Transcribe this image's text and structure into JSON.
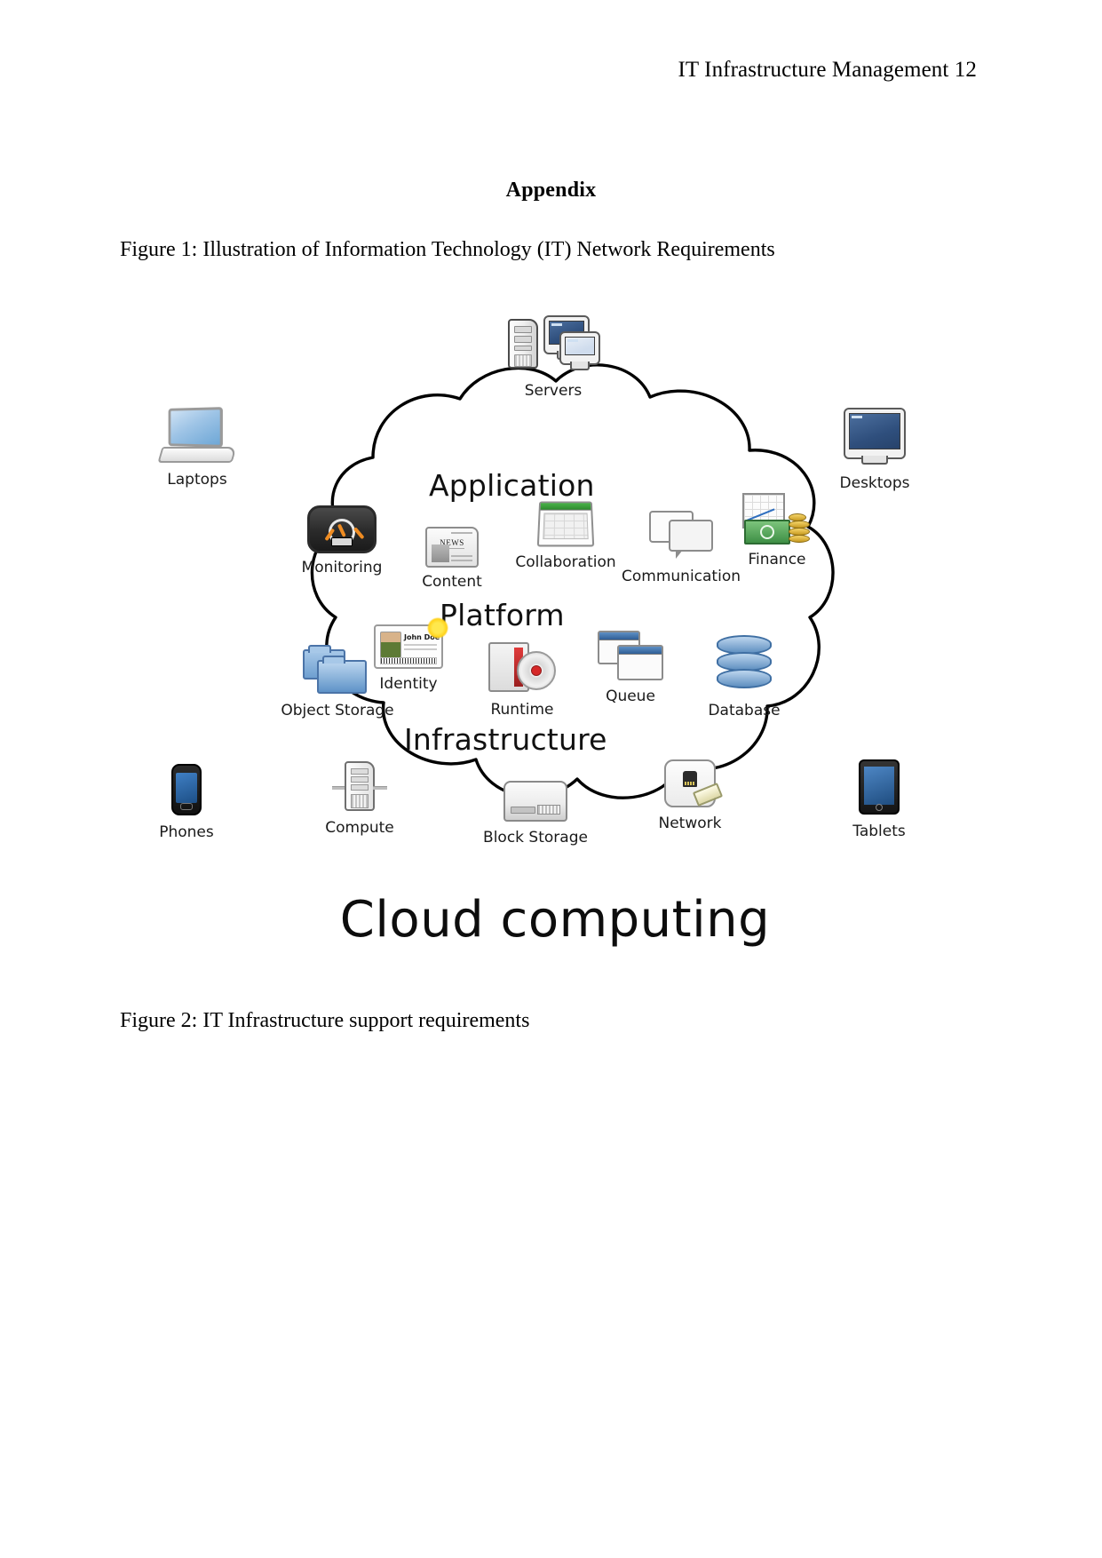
{
  "header": {
    "running_head": "IT Infrastructure Management 12"
  },
  "appendix": {
    "title": "Appendix"
  },
  "figures": {
    "figure1_caption": "Figure 1: Illustration of Information Technology (IT) Network Requirements",
    "figure2_caption": "Figure 2: IT Infrastructure support requirements"
  },
  "diagram": {
    "title": "Cloud computing",
    "tiers": [
      {
        "label": "Application"
      },
      {
        "label": "Platform"
      },
      {
        "label": "Infrastructure"
      }
    ],
    "external_devices": [
      {
        "label": "Servers",
        "icon": "servers-icon"
      },
      {
        "label": "Laptops",
        "icon": "laptop-icon"
      },
      {
        "label": "Desktops",
        "icon": "desktop-monitor-icon"
      },
      {
        "label": "Phones",
        "icon": "smartphone-icon"
      },
      {
        "label": "Tablets",
        "icon": "tablet-icon"
      }
    ],
    "application_services": [
      {
        "label": "Monitoring",
        "icon": "gauge-icon"
      },
      {
        "label": "Content",
        "icon": "newspaper-icon"
      },
      {
        "label": "Collaboration",
        "icon": "spreadsheet-icon"
      },
      {
        "label": "Communication",
        "icon": "chat-bubbles-icon"
      },
      {
        "label": "Finance",
        "icon": "money-coins-icon"
      }
    ],
    "platform_services": [
      {
        "label": "Object Storage",
        "icon": "folders-icon"
      },
      {
        "label": "Identity",
        "icon": "id-card-icon"
      },
      {
        "label": "Runtime",
        "icon": "disc-icon"
      },
      {
        "label": "Queue",
        "icon": "stacked-windows-icon"
      },
      {
        "label": "Database",
        "icon": "database-cylinder-icon"
      }
    ],
    "infrastructure_services": [
      {
        "label": "Compute",
        "icon": "rack-server-icon"
      },
      {
        "label": "Block Storage",
        "icon": "disk-box-icon"
      },
      {
        "label": "Network",
        "icon": "network-jack-icon"
      }
    ],
    "identity_card_name": "John Doe",
    "content_icon_text": "NEWS",
    "colors": {
      "text": "#1a1a1a",
      "cloud_outline": "#000000",
      "database_blue": "#5f8fc0",
      "folder_blue": "#6e9fd0",
      "finance_green": "#3e8f45",
      "gauge_orange": "#ef8c22"
    }
  }
}
